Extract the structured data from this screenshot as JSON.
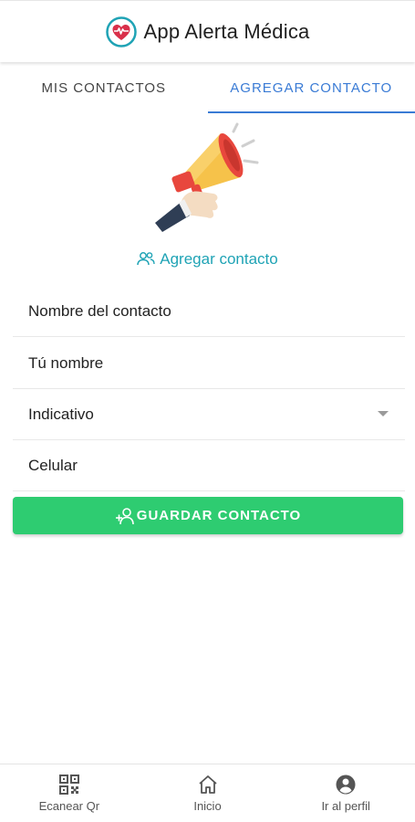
{
  "header": {
    "title": "App Alerta Médica",
    "logo_icon": "heart-pulse-icon"
  },
  "tabs": [
    {
      "label": "MIS CONTACTOS",
      "active": false
    },
    {
      "label": "AGREGAR CONTACTO",
      "active": true
    }
  ],
  "hero": {
    "icon": "megaphone-icon"
  },
  "section": {
    "label": "Agregar contacto",
    "icon": "users-icon"
  },
  "form": {
    "contact_name_placeholder": "Nombre del contacto",
    "your_name_placeholder": "Tú nombre",
    "prefix_placeholder": "Indicativo",
    "phone_placeholder": "Celular"
  },
  "save_button": {
    "label": "GUARDAR CONTACTO",
    "icon": "user-add-icon"
  },
  "bottom_nav": [
    {
      "label": "Ecanear Qr",
      "icon": "qr-code-icon"
    },
    {
      "label": "Inicio",
      "icon": "home-icon"
    },
    {
      "label": "Ir al perfil",
      "icon": "account-circle-icon"
    }
  ],
  "colors": {
    "accent": "#3a7bd5",
    "teal": "#1fa3b5",
    "success": "#2ecc71",
    "logo_red": "#d9304a"
  }
}
